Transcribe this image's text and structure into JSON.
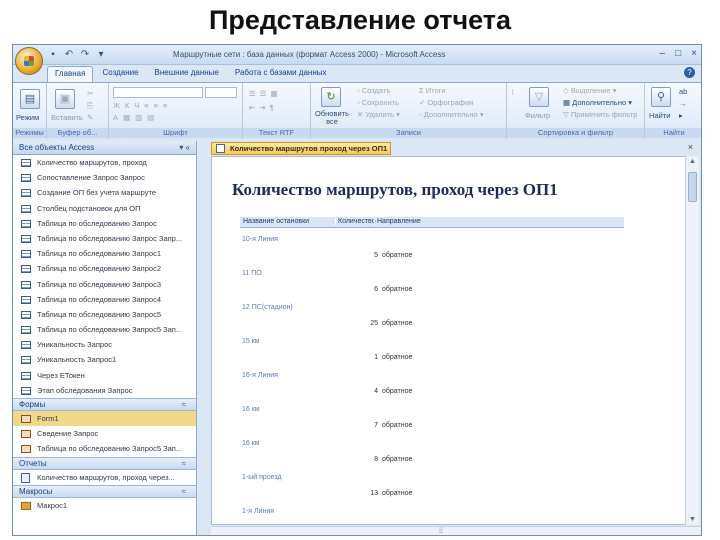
{
  "slide_title": "Представление отчета",
  "window": {
    "title": "Маршрутные сети : база данных (формат Access 2000) - Microsoft Access",
    "quick_access": [
      "save-icon",
      "undo-icon",
      "redo-icon",
      "dropdown-icon"
    ],
    "controls": [
      "–",
      "□",
      "×"
    ]
  },
  "tabs": [
    "Главная",
    "Создание",
    "Внешние данные",
    "Работа с базами данных"
  ],
  "ribbon": {
    "groups": [
      "Режимы",
      "Буфер об...",
      "Шрифт",
      "Текст RTF",
      "Записи",
      "Сортировка и фильтр",
      "Найти"
    ],
    "buttons": {
      "view": "Режим",
      "paste": "Вставить",
      "refresh": "Обновить все",
      "create": "Создать",
      "save": "Сохранить",
      "delete": "Удалить",
      "totals": "Итоги",
      "spelling": "Орфография",
      "more": "Дополнительно",
      "filter": "Фильтр",
      "selection": "Выделение",
      "advanced": "Дополнительно",
      "toggle_filter": "Применить фильтр",
      "find": "Найти"
    }
  },
  "nav": {
    "header": "Все объекты Access",
    "queries": [
      "Количество маршрутов, проход",
      "Сопоставление Запрос Запрос",
      "Создание ОП без учета маршруте",
      "Столбец подстановок для ОП",
      "Таблица по обследованию Запрос",
      "Таблица по обследованию Запрос Запр...",
      "Таблица по обследованию Запрос1",
      "Таблица по обследованию Запрос2",
      "Таблица по обследованию Запрос3",
      "Таблица по обследованию Запрос4",
      "Таблица по обследованию Запрос5",
      "Таблица по обследованию Запрос5 Зап...",
      "Уникальность Запрос",
      "Уникальность Запрос1",
      "Через ЕТокен",
      "Этап обследования Запрос"
    ],
    "forms_header": "Формы",
    "forms": [
      "Form1",
      "Сведение Запрос",
      "Таблица по обследованию Запрос5 Зап..."
    ],
    "reports_header": "Отчеты",
    "reports": [
      "Количество маршрутов, проход через..."
    ],
    "macros_header": "Макросы",
    "macros": [
      "Макрос1"
    ]
  },
  "document": {
    "tab_label": "Количество маршрутов проход через ОП1",
    "report_title": "Количество маршрутов, проход через ОП1",
    "columns": [
      "Название остановки",
      "Количество",
      "Направление"
    ],
    "groups": [
      {
        "stop": "10-я Линия",
        "count": "5",
        "direction": "обратное"
      },
      {
        "stop": "11 ПО",
        "count": "6",
        "direction": "обратное"
      },
      {
        "stop": "12 ПС(стадион)",
        "count": "25",
        "direction": "обратное"
      },
      {
        "stop": "15 км",
        "count": "1",
        "direction": "обратное"
      },
      {
        "stop": "16-я Линия",
        "count": "4",
        "direction": "обратное"
      },
      {
        "stop": "16 км",
        "count": "7",
        "direction": "обратное"
      },
      {
        "stop": "16 км",
        "count": "8",
        "direction": "обратное"
      },
      {
        "stop": "1-ый проезд",
        "count": "13",
        "direction": "обратное"
      },
      {
        "stop": "1-я Линия",
        "count": "",
        "direction": ""
      }
    ]
  }
}
